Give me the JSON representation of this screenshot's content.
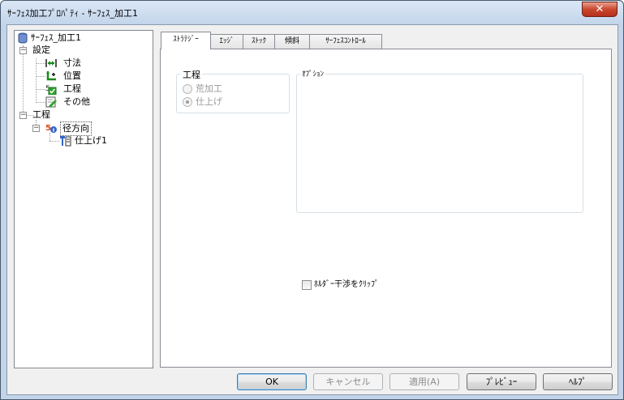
{
  "window": {
    "title": "ｻｰﾌｪｽ加工ﾌﾟﾛﾊﾟﾃｨ - ｻｰﾌｪｽ_加工1",
    "close_glyph": "✕"
  },
  "tree": {
    "root": "ｻｰﾌｪｽ_加工1",
    "settings": "設定",
    "settings_children": [
      "寸法",
      "位置",
      "工程",
      "その他"
    ],
    "process": "工程",
    "radial": "径方向",
    "finish": "仕上げ1"
  },
  "tabs": [
    "ｽﾄﾗﾃｼﾞｰ",
    "ｴｯｼﾞ",
    "ｽﾄｯｸ",
    "傾斜",
    "ｻｰﾌｪｽｺﾝﾄﾛｰﾙ"
  ],
  "strategy": {
    "process_group": "工程",
    "radio_options": [
      {
        "label": "荒加工",
        "checked": false
      },
      {
        "label": "仕上げ",
        "checked": true
      }
    ],
    "options_group": "ｵﾌﾟｼｮﾝ",
    "clip_checkbox": {
      "label": "ﾎﾙﾀﾞｰ干渉をｸﾘｯﾌﾟ",
      "checked": false
    }
  },
  "buttons": {
    "ok": "OK",
    "cancel": "キャンセル",
    "apply": "適用(A)",
    "preview": "ﾌﾟﾚﾋﾞｭｰ",
    "help": "ﾍﾙﾌﾟ"
  }
}
